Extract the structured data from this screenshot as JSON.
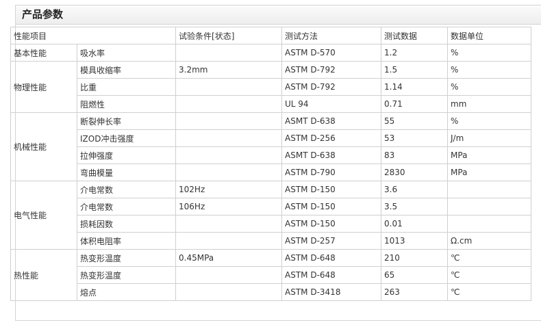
{
  "panel": {
    "title": "产品参数"
  },
  "table": {
    "headers": {
      "item": "性能项目",
      "condition": "试验条件[状态]",
      "method": "测试方法",
      "value": "测试数据",
      "unit": "数据单位"
    },
    "groups": [
      {
        "name": "基本性能",
        "rows": [
          {
            "prop": "吸水率",
            "cond": "",
            "method": "ASTM D-570",
            "value": "1.2",
            "unit": "%"
          }
        ]
      },
      {
        "name": "物理性能",
        "rows": [
          {
            "prop": "模具收缩率",
            "cond": "3.2mm",
            "method": "ASTM D-792",
            "value": "1.5",
            "unit": "%"
          },
          {
            "prop": "比重",
            "cond": "",
            "method": "ASTM D-792",
            "value": "1.14",
            "unit": "%"
          },
          {
            "prop": "阻燃性",
            "cond": "",
            "method": "UL 94",
            "value": "0.71",
            "unit": "mm"
          }
        ]
      },
      {
        "name": "机械性能",
        "rows": [
          {
            "prop": "断裂伸长率",
            "cond": "",
            "method": "ASMT D-638",
            "value": "55",
            "unit": "%"
          },
          {
            "prop": "IZOD冲击强度",
            "cond": "",
            "method": "ASTM D-256",
            "value": "53",
            "unit": "J/m"
          },
          {
            "prop": "拉伸强度",
            "cond": "",
            "method": "ASMT D-638",
            "value": "83",
            "unit": "MPa"
          },
          {
            "prop": "弯曲模量",
            "cond": "",
            "method": "ASTM D-790",
            "value": "2830",
            "unit": "MPa"
          }
        ]
      },
      {
        "name": "电气性能",
        "rows": [
          {
            "prop": "介电常数",
            "cond": "102Hz",
            "method": "ASTM D-150",
            "value": "3.6",
            "unit": ""
          },
          {
            "prop": "介电常数",
            "cond": "106Hz",
            "method": "ASTM D-150",
            "value": "3.5",
            "unit": ""
          },
          {
            "prop": "损耗因数",
            "cond": "",
            "method": "ASTM D-150",
            "value": "0.01",
            "unit": ""
          },
          {
            "prop": "体积电阻率",
            "cond": "",
            "method": "ASTM D-257",
            "value": "1013",
            "unit": "Ω.cm"
          }
        ]
      },
      {
        "name": "热性能",
        "rows": [
          {
            "prop": "热变形温度",
            "cond": "0.45MPa",
            "method": "ASTM D-648",
            "value": "210",
            "unit": "℃"
          },
          {
            "prop": "热变形温度",
            "cond": "",
            "method": "ASTM D-648",
            "value": "65",
            "unit": "℃"
          },
          {
            "prop": "熔点",
            "cond": "",
            "method": "ASTM D-3418",
            "value": "263",
            "unit": "℃"
          }
        ]
      }
    ]
  }
}
